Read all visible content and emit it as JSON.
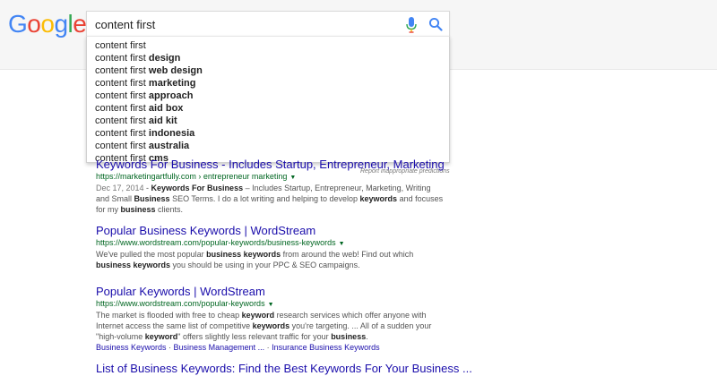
{
  "logo": {
    "letters": [
      "G",
      "o",
      "o",
      "g",
      "l",
      "e"
    ],
    "colors": [
      "#4285F4",
      "#EA4335",
      "#FBBC05",
      "#4285F4",
      "#34A853",
      "#EA4335"
    ]
  },
  "search": {
    "value": "content first"
  },
  "icons": {
    "mic": "microphone-icon",
    "search": "search-icon"
  },
  "suggestions": [
    {
      "prefix": "content first",
      "suffix": ""
    },
    {
      "prefix": "content first",
      "suffix": "design"
    },
    {
      "prefix": "content first",
      "suffix": "web design"
    },
    {
      "prefix": "content first",
      "suffix": "marketing"
    },
    {
      "prefix": "content first",
      "suffix": "approach"
    },
    {
      "prefix": "content first",
      "suffix": "aid box"
    },
    {
      "prefix": "content first",
      "suffix": "aid kit"
    },
    {
      "prefix": "content first",
      "suffix": "indonesia"
    },
    {
      "prefix": "content first",
      "suffix": "australia"
    },
    {
      "prefix": "content first",
      "suffix": "cms"
    }
  ],
  "report_text": "Report inappropriate predictions",
  "results": [
    {
      "title": "Keywords For Business - Includes Startup, Entrepreneur, Marketing",
      "url": "https://marketingartfully.com › entrepreneur marketing",
      "date": "Dec 17, 2014",
      "snippet_1": " - ",
      "snippet_2": "Keywords For Business",
      "snippet_3": " – Includes Startup, Entrepreneur, Marketing, Writing and Small",
      "snippet_4": "Business",
      "snippet_5": " SEO Terms. I do a lot writing and helping to develop ",
      "snippet_6": "keywords",
      "snippet_7": " and focuses for my ",
      "snippet_8": "business",
      "snippet_9": " clients."
    },
    {
      "title": "Popular Business Keywords | WordStream",
      "url": "https://www.wordstream.com/popular-keywords/business-keywords",
      "snippet_1": "We've pulled the most popular ",
      "snippet_2": "business keywords",
      "snippet_3": " from around the web! Find out which ",
      "snippet_4": "business keywords",
      "snippet_5": " you should be using in your PPC & SEO campaigns."
    },
    {
      "title": "Popular Keywords | WordStream",
      "url": "https://www.wordstream.com/popular-keywords",
      "snippet_1": "The market is flooded with free to cheap ",
      "snippet_2": "keyword",
      "snippet_3": " research services which offer anyone with Internet access the same list of competitive ",
      "snippet_4": "keywords",
      "snippet_5": " you're targeting. ... All of a sudden your \"high-volume ",
      "snippet_6": "keyword",
      "snippet_7": "\" offers slightly less relevant traffic for your ",
      "snippet_8": "business",
      "snippet_9": ".",
      "sitelinks": [
        "Business Keywords",
        "Business Management ...",
        "Insurance Business Keywords"
      ],
      "sitelink_sep": " · "
    },
    {
      "title": "List of Business Keywords: Find the Best Keywords For Your Business ..."
    }
  ]
}
